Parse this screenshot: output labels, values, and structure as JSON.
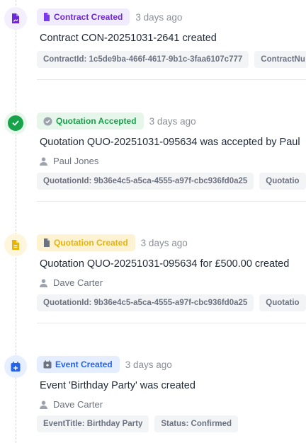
{
  "events": [
    {
      "badge": "Contract Created",
      "time": "3 days ago",
      "title": "Contract CON-20251031-2641 created",
      "chips": [
        "ContractId: 1c5de9ba-466f-4617-9b1c-3faa6107c777",
        "ContractNu"
      ],
      "icon": "document-icon",
      "color": "#6d28d9"
    },
    {
      "badge": "Quotation Accepted",
      "time": "3 days ago",
      "title": "Quotation QUO-20251031-095634 was accepted by Paul",
      "actor": "Paul Jones",
      "chips": [
        "QuotationId: 9b36e4c5-a5ca-4555-a97f-cbc936fd0a25",
        "Quotatio"
      ],
      "icon": "check-icon",
      "color": "#16a34a"
    },
    {
      "badge": "Quotation Created",
      "time": "3 days ago",
      "title": "Quotation QUO-20251031-095634 for £500.00 created",
      "actor": "Dave Carter",
      "chips": [
        "QuotationId: 9b36e4c5-a5ca-4555-a97f-cbc936fd0a25",
        "Quotatio"
      ],
      "icon": "document-icon",
      "color": "#eab308"
    },
    {
      "badge": "Event Created",
      "time": "3 days ago",
      "title": "Event 'Birthday Party' was created",
      "actor": "Dave Carter",
      "chips": [
        "EventTitle: Birthday Party",
        "Status: Confirmed"
      ],
      "icon": "calendar-icon",
      "color": "#2563eb"
    }
  ]
}
